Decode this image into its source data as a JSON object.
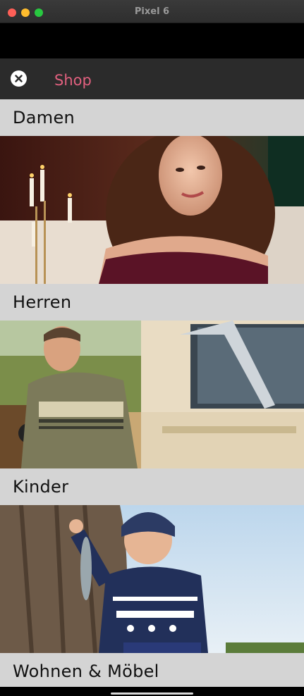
{
  "window": {
    "title": "Pixel 6"
  },
  "appbar": {
    "title": "Shop",
    "close_icon": "close-icon"
  },
  "categories": [
    {
      "label": "Damen",
      "image": "woman-portrait-candles"
    },
    {
      "label": "Herren",
      "image": "man-in-car-hoodie"
    },
    {
      "label": "Kinder",
      "image": "boy-with-fish-sweater"
    },
    {
      "label": "Wohnen & Möbel",
      "image": "home-furniture"
    }
  ],
  "colors": {
    "accent": "#e0607e",
    "header_bg": "#d4d4d4",
    "appbar_bg": "#2b2b2b"
  }
}
